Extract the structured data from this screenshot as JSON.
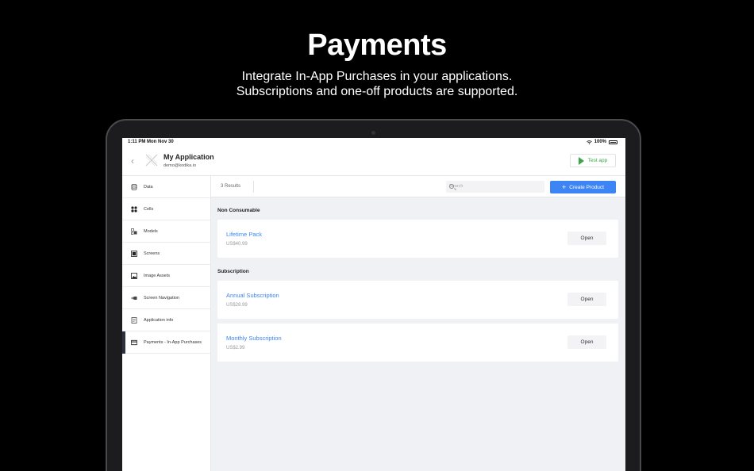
{
  "hero": {
    "title": "Payments",
    "subtitle_line1": "Integrate In-App Purchases in your applications.",
    "subtitle_line2": "Subscriptions and one-off products are supported."
  },
  "status_bar": {
    "time": "1:11 PM  Mon Nov 30",
    "battery": "100%"
  },
  "app": {
    "name": "My Application",
    "email": "demo@kodika.io"
  },
  "topbar": {
    "test_button": "Test app"
  },
  "sidebar": {
    "items": [
      {
        "label": "Data",
        "icon": "database-icon"
      },
      {
        "label": "Cells",
        "icon": "cells-icon"
      },
      {
        "label": "Models",
        "icon": "models-icon"
      },
      {
        "label": "Screens",
        "icon": "screen-icon"
      },
      {
        "label": "Image Assets",
        "icon": "image-icon"
      },
      {
        "label": "Screen Navigation",
        "icon": "navigation-icon"
      },
      {
        "label": "Application info",
        "icon": "document-icon"
      },
      {
        "label": "Payments - In-App Purchases",
        "icon": "card-icon"
      }
    ]
  },
  "toolbar": {
    "results": "3 Results",
    "search_placeholder": "Search",
    "create_button": "Create Product"
  },
  "sections": [
    {
      "title": "Non Consumable",
      "products": [
        {
          "name": "Lifetime Pack",
          "price": "US$40.99",
          "action": "Open"
        }
      ]
    },
    {
      "title": "Subscription",
      "products": [
        {
          "name": "Annual Subscription",
          "price": "US$28.99",
          "action": "Open"
        },
        {
          "name": "Monthly Subscription",
          "price": "US$2.99",
          "action": "Open"
        }
      ]
    }
  ],
  "colors": {
    "accent": "#3d84f5",
    "success": "#3aa84a",
    "sidebar_active": "#2c2f3e"
  }
}
